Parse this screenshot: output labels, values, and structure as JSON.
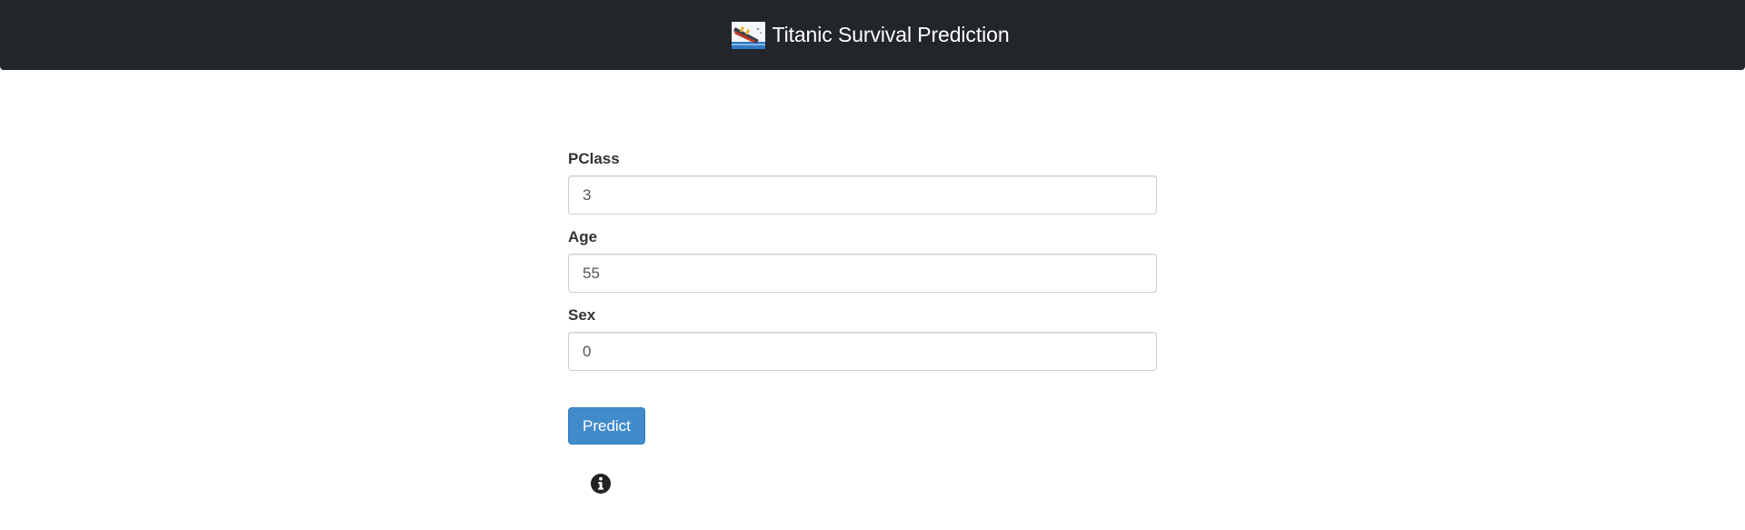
{
  "navbar": {
    "title": "Titanic Survival Prediction",
    "logo_icon": "titanic-ship-logo-icon"
  },
  "form": {
    "fields": [
      {
        "label": "PClass",
        "value": "3"
      },
      {
        "label": "Age",
        "value": "55"
      },
      {
        "label": "Sex",
        "value": "0"
      }
    ],
    "submit_label": "Predict"
  },
  "result": {
    "icon": "info-circle-icon"
  },
  "colors": {
    "navbar_bg": "#222529",
    "button_primary": "#428bca",
    "label_text": "#333333",
    "input_border": "#cccccc"
  }
}
